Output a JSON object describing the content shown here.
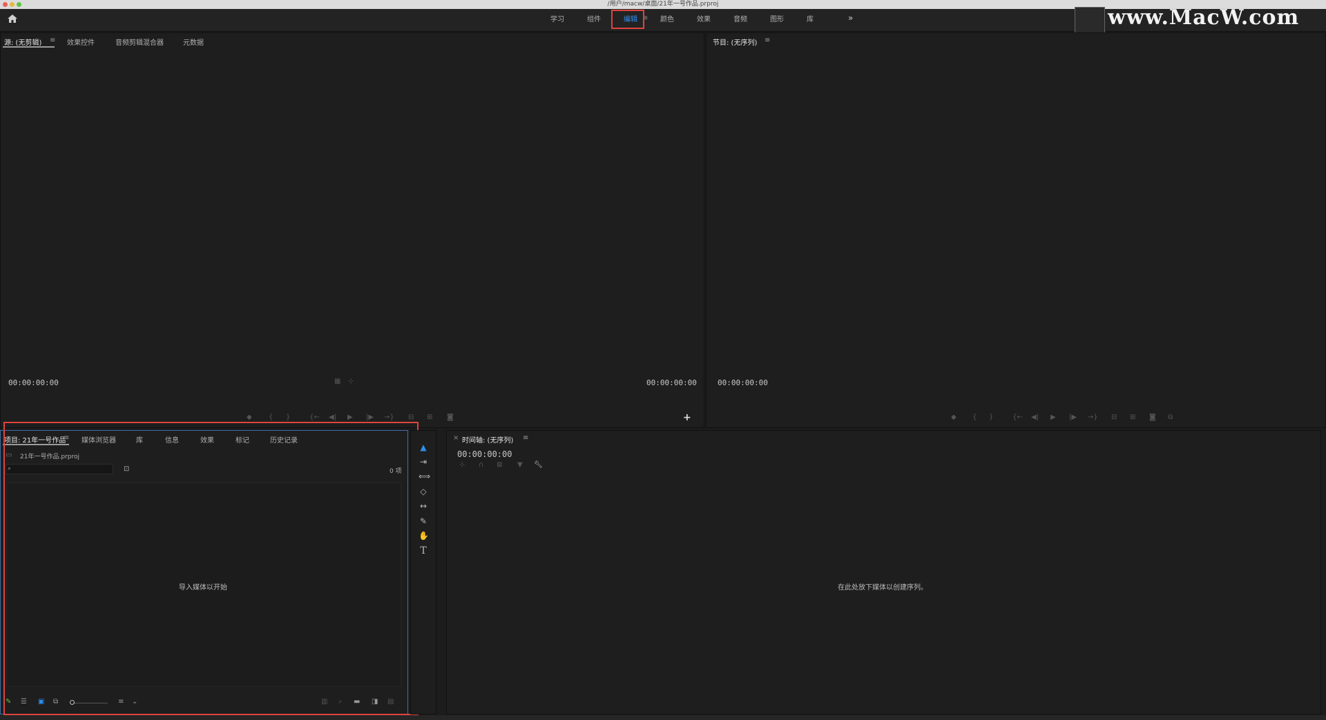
{
  "window": {
    "title": "/用户/macw/桌面/21年一号作品.prproj",
    "controls": [
      "#ec5f57",
      "#e0bb3d",
      "#5ec346"
    ]
  },
  "header": {
    "workspaces": [
      {
        "label": "学习",
        "active": false
      },
      {
        "label": "组件",
        "active": false
      },
      {
        "label": "编辑",
        "active": true
      },
      {
        "label": "颜色",
        "active": false
      },
      {
        "label": "效果",
        "active": false
      },
      {
        "label": "音频",
        "active": false
      },
      {
        "label": "图形",
        "active": false
      },
      {
        "label": "库",
        "active": false
      }
    ],
    "menu_glyph": "≡",
    "more_glyph": "»",
    "watermark": "www.MacW.com"
  },
  "source_panel": {
    "tabs": [
      "源: (无剪辑)",
      "效果控件",
      "音频剪辑混合器",
      "元数据"
    ],
    "menu_glyph": "≡",
    "timecode_left": "00:00:00:00",
    "timecode_right": "00:00:00:00",
    "add_glyph": "+"
  },
  "program_panel": {
    "title": "节目: (无序列)",
    "menu_glyph": "≡",
    "timecode_left": "00:00:00:00"
  },
  "project_panel": {
    "tabs": [
      "项目: 21年一号作品",
      "媒体浏览器",
      "库",
      "信息",
      "效果",
      "标记",
      "历史记录"
    ],
    "menu_glyph": "≡",
    "file_name": "21年一号作品.prproj",
    "search_placeholder": "",
    "item_count": "0 项",
    "empty_text": "导入媒体以开始"
  },
  "timeline_panel": {
    "close_glyph": "×",
    "title": "时间轴: (无序列)",
    "menu_glyph": "≡",
    "timecode": "00:00:00:00",
    "empty_text": "在此处放下媒体以创建序列。"
  },
  "tools": [
    {
      "icon": "selection-tool-icon",
      "glyph": "▲"
    },
    {
      "icon": "track-select-tool-icon",
      "glyph": "⇥"
    },
    {
      "icon": "ripple-edit-tool-icon",
      "glyph": "⟺"
    },
    {
      "icon": "razor-tool-icon",
      "glyph": "◇"
    },
    {
      "icon": "slip-tool-icon",
      "glyph": "↔"
    },
    {
      "icon": "pen-tool-icon",
      "glyph": "✎"
    },
    {
      "icon": "hand-tool-icon",
      "glyph": "✋"
    },
    {
      "icon": "type-tool-icon",
      "glyph": "T"
    }
  ],
  "colors": {
    "accent": "#2f8ff0",
    "highlight_box": "#e0443e",
    "panel_bg": "#1e1e1e",
    "app_bg": "#1c1c1c"
  }
}
